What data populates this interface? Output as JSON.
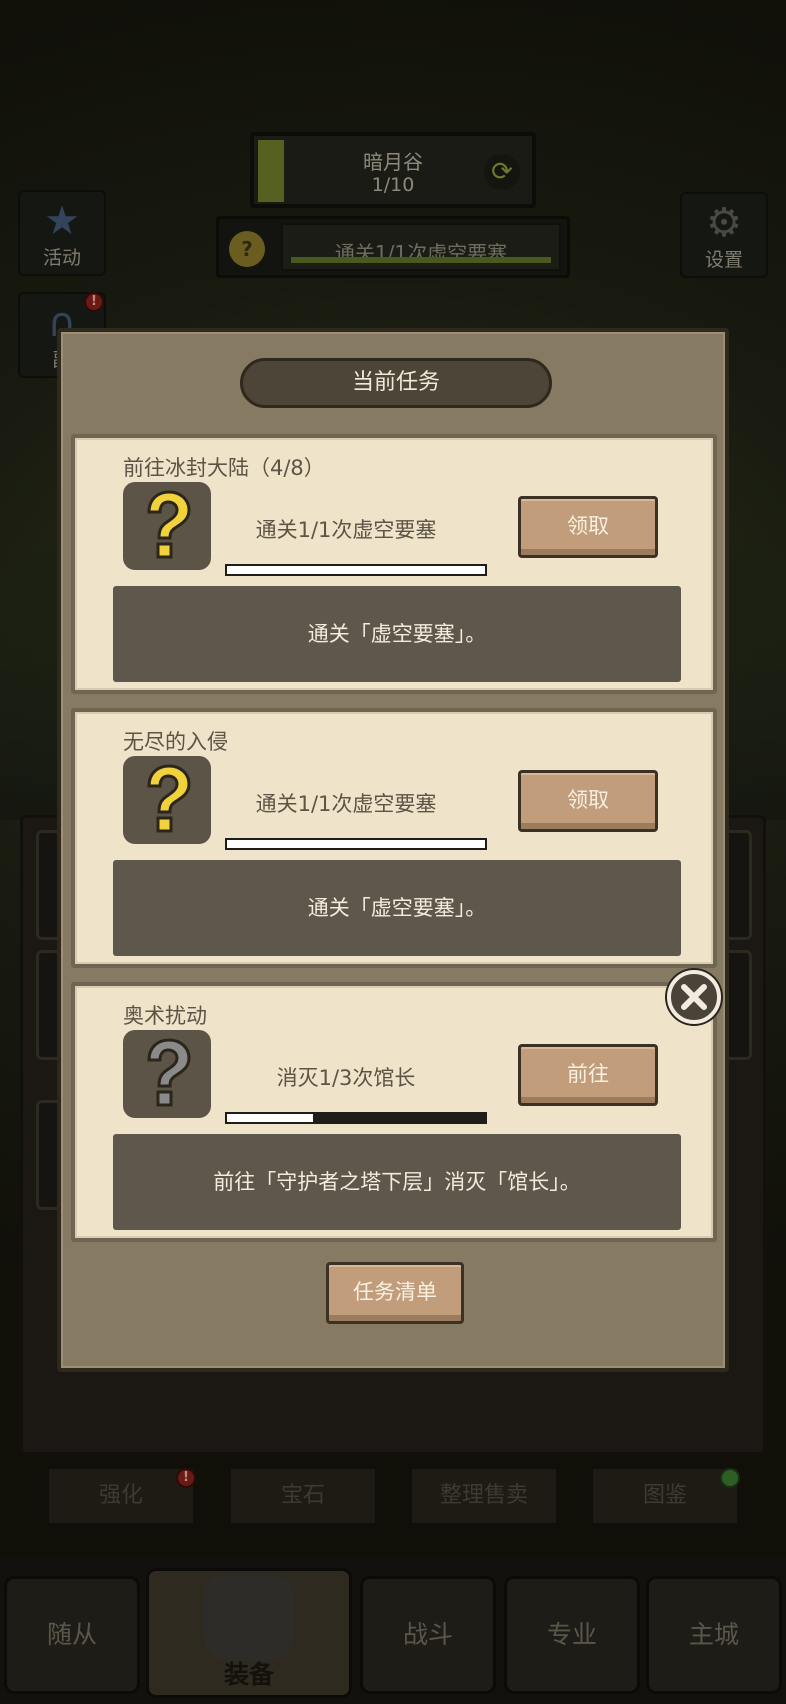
{
  "hud": {
    "stage": {
      "name": "暗月谷",
      "progress": "1/10"
    },
    "quest_strip": {
      "text": "通关1/1次虚空要塞"
    },
    "left_buttons": [
      {
        "label": "活动"
      },
      {
        "label": "副"
      }
    ],
    "right_buttons": [
      {
        "label": "设置"
      }
    ]
  },
  "sub_menu": {
    "items": [
      {
        "label": "强化"
      },
      {
        "label": "宝石"
      },
      {
        "label": "整理售卖"
      },
      {
        "label": "图鉴"
      }
    ]
  },
  "tabbar": {
    "tabs": [
      {
        "label": "随从"
      },
      {
        "label": "装备"
      },
      {
        "label": "战斗"
      },
      {
        "label": "专业"
      },
      {
        "label": "主城"
      }
    ],
    "active": "装备"
  },
  "modal": {
    "title": "当前任务",
    "tasks": [
      {
        "name": "前往冰封大陆（4/8）",
        "goal": "通关1/1次虚空要塞",
        "progress": 1.0,
        "button": "领取",
        "description": "通关「虚空要塞」。",
        "icon": "question-mark-icon-yellow"
      },
      {
        "name": "无尽的入侵",
        "goal": "通关1/1次虚空要塞",
        "progress": 1.0,
        "button": "领取",
        "description": "通关「虚空要塞」。",
        "icon": "question-mark-icon-yellow"
      },
      {
        "name": "奥术扰动",
        "goal": "消灭1/3次馆长",
        "progress": 0.333,
        "button": "前往",
        "description": "前往「守护者之塔下层」消灭「馆长」。",
        "icon": "question-mark-icon-gray"
      }
    ],
    "list_button": "任务清单"
  },
  "colors": {
    "card_bg": "#efe4c9",
    "modal_bg": "#877a62",
    "wood_button": "#c19d7b",
    "question_yellow": "#f2d23a",
    "question_gray": "#8a8a8a"
  }
}
